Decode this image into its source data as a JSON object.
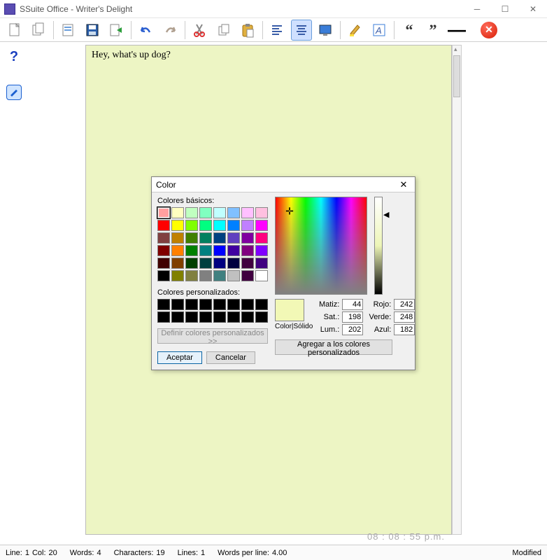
{
  "window": {
    "title": "SSuite Office - Writer's Delight"
  },
  "document": {
    "text": "Hey, what's up dog?"
  },
  "clock": "08 : 08 : 55  p.m.",
  "status": {
    "line_label": "Line:",
    "line": "1",
    "col_label": "Col:",
    "col": "20",
    "words_label": "Words:",
    "words": "4",
    "chars_label": "Characters:",
    "chars": "19",
    "lines_label": "Lines:",
    "lines": "1",
    "wpl_label": "Words per line:",
    "wpl": "4.00",
    "modified": "Modified"
  },
  "toolbar": {
    "items": [
      "new-doc",
      "copy-doc",
      "open-doc",
      "save-doc",
      "export-doc",
      "undo",
      "redo",
      "cut",
      "copy",
      "paste",
      "align-left",
      "align-center",
      "screen",
      "highlight",
      "font-style",
      "quote-open",
      "quote-close",
      "dash",
      "close-app"
    ]
  },
  "dialog": {
    "title": "Color",
    "basic_label": "Colores básicos:",
    "custom_label": "Colores personalizados:",
    "define_btn": "Definir colores personalizados >>",
    "ok": "Aceptar",
    "cancel": "Cancelar",
    "preview_label": "Color|Sólido",
    "add_btn": "Agregar a los colores personalizados",
    "hsl": {
      "h_label": "Matiz:",
      "h": "44",
      "s_label": "Sat.:",
      "s": "198",
      "l_label": "Lum.:",
      "l": "202"
    },
    "rgb": {
      "r_label": "Rojo:",
      "r": "242",
      "g_label": "Verde:",
      "g": "248",
      "b_label": "Azul:",
      "b": "182"
    },
    "basic_colors": [
      "#ff9f9f",
      "#ffffc0",
      "#c0ffc0",
      "#80ffc0",
      "#c0ffff",
      "#80c0ff",
      "#ffc0ff",
      "#ffc0e0",
      "#ff0000",
      "#ffff00",
      "#80ff00",
      "#00ff80",
      "#00ffff",
      "#0080ff",
      "#c080ff",
      "#ff00ff",
      "#804040",
      "#c08000",
      "#408000",
      "#008060",
      "#004080",
      "#6040c0",
      "#8000a0",
      "#ff0080",
      "#800000",
      "#ff8000",
      "#008000",
      "#008080",
      "#0000ff",
      "#4000a0",
      "#800080",
      "#8000ff",
      "#400000",
      "#804000",
      "#004000",
      "#004040",
      "#000080",
      "#000040",
      "#400040",
      "#400080",
      "#000000",
      "#808000",
      "#808040",
      "#808080",
      "#408080",
      "#c0c0c0",
      "#400040",
      "#ffffff"
    ],
    "selected_index": 0,
    "custom_count": 16
  }
}
